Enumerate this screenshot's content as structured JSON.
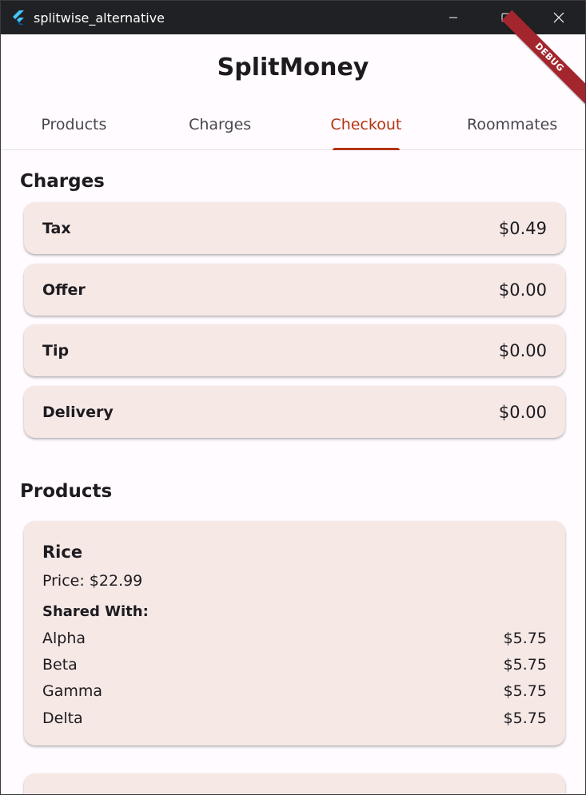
{
  "window": {
    "title": "splitwise_alternative",
    "app_icon": "flutter-icon",
    "controls": [
      "minimize-icon",
      "maximize-icon",
      "close-icon"
    ]
  },
  "debug_banner": "DEBUG",
  "appbar": {
    "title": "SplitMoney"
  },
  "tabs": [
    {
      "label": "Products",
      "active": false
    },
    {
      "label": "Charges",
      "active": false
    },
    {
      "label": "Checkout",
      "active": true
    },
    {
      "label": "Roommates",
      "active": false
    }
  ],
  "charges": {
    "heading": "Charges",
    "items": [
      {
        "label": "Tax",
        "amount": "$0.49"
      },
      {
        "label": "Offer",
        "amount": "$0.00"
      },
      {
        "label": "Tip",
        "amount": "$0.00"
      },
      {
        "label": "Delivery",
        "amount": "$0.00"
      }
    ]
  },
  "products": {
    "heading": "Products",
    "items": [
      {
        "name": "Rice",
        "price": "Price: $22.99",
        "shared_label": "Shared With:",
        "shares": [
          {
            "name": "Alpha",
            "amount": "$5.75"
          },
          {
            "name": "Beta",
            "amount": "$5.75"
          },
          {
            "name": "Gamma",
            "amount": "$5.75"
          },
          {
            "name": "Delta",
            "amount": "$5.75"
          }
        ]
      }
    ]
  },
  "colors": {
    "accent": "#b3340e",
    "card_bg": "#f5e8e5",
    "page_bg": "#fffbfe",
    "titlebar_bg": "#202124",
    "debug_banner": "#a3262e"
  }
}
